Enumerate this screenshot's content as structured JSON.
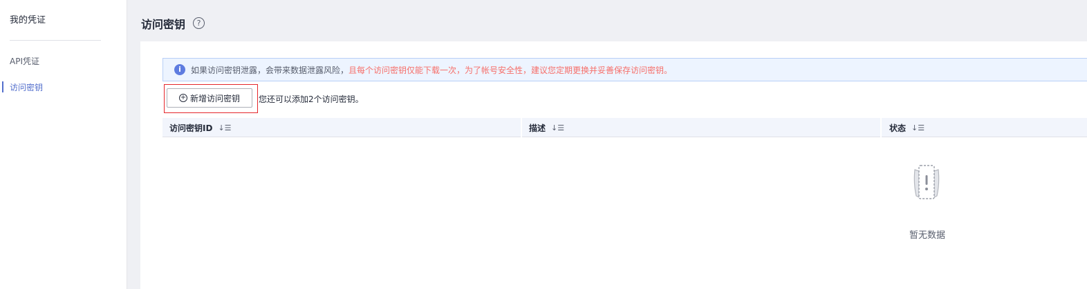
{
  "sidebar": {
    "title": "我的凭证",
    "items": [
      {
        "label": "API凭证",
        "active": false
      },
      {
        "label": "访问密钥",
        "active": true
      }
    ]
  },
  "header": {
    "title": "访问密钥",
    "help_icon": "question-circle-icon"
  },
  "alert": {
    "icon": "info-icon",
    "text_normal": "如果访问密钥泄露，会带来数据泄露风险，",
    "text_warning": "且每个访问密钥仅能下载一次，为了帐号安全性，建议您定期更换并妥善保存访问密钥。"
  },
  "toolbar": {
    "add_label": "新增访问密钥",
    "remaining_text": "您还可以添加2个访问密钥。"
  },
  "table": {
    "columns": [
      {
        "label": "访问密钥ID",
        "sort_icon": "↓☰"
      },
      {
        "label": "描述",
        "sort_icon": "↓☰"
      },
      {
        "label": "状态",
        "sort_icon": "↓☰"
      }
    ],
    "empty_text": "暂无数据"
  },
  "colors": {
    "accent": "#526ecc",
    "alert_bg": "#edf4ff",
    "warning": "#f66f6a",
    "highlight": "#e5252a"
  }
}
